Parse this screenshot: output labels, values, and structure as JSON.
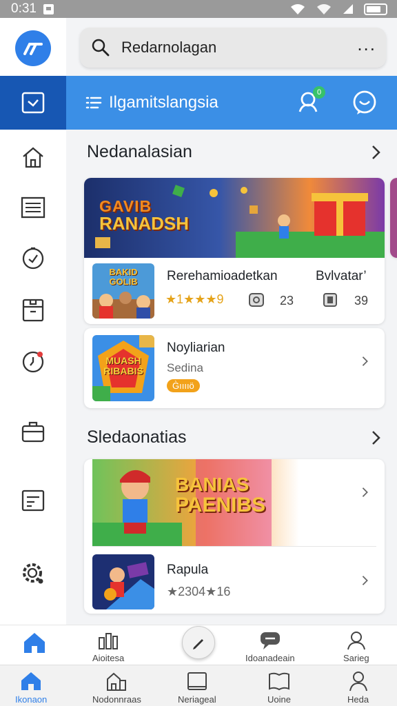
{
  "status": {
    "time": "0:31"
  },
  "search": {
    "text": "Redarnolagan"
  },
  "header": {
    "title": "Ilgamitslangsia",
    "badge_count": "0"
  },
  "sections": [
    {
      "title": "Nedanalasian"
    },
    {
      "title": "Sledaonatias"
    }
  ],
  "featured": {
    "banner_title_line1": "GAVIB",
    "banner_title_line2": "RANADSH",
    "item": {
      "thumb_text_line1": "BAKID",
      "thumb_text_line2": "GOLIB",
      "title": "Rerehamioadetkan",
      "extra": "Bvlvatar’",
      "rating": "★1★★★9",
      "stat1": "23",
      "stat2": "39"
    }
  },
  "card2": {
    "thumb_text_line1": "MUASH",
    "thumb_text_line2": "RIBABIS",
    "title": "Noyliarian",
    "sub": "Sedina",
    "badge": "G̀ııııö"
  },
  "promo": {
    "banner_line1": "BANIAS",
    "banner_line2": "PAENIBS",
    "item": {
      "title": "Rapula",
      "rating": "★2304★16"
    }
  },
  "tabs_top": [
    {
      "label": ""
    },
    {
      "label": "Aioitesa"
    },
    {
      "label": ""
    },
    {
      "label": "Idoanadeain"
    },
    {
      "label": "Sarieg"
    }
  ],
  "tabs_bottom": [
    {
      "label": "Ikonaon"
    },
    {
      "label": "Nodonnraas"
    },
    {
      "label": "Neriageal"
    },
    {
      "label": "Uoine"
    },
    {
      "label": "Heda"
    }
  ],
  "colors": {
    "accent": "#3b8fe6",
    "sidebar_active": "#1757b3",
    "logo": "#2f7fe8",
    "badge_orange": "#f2a21a"
  }
}
